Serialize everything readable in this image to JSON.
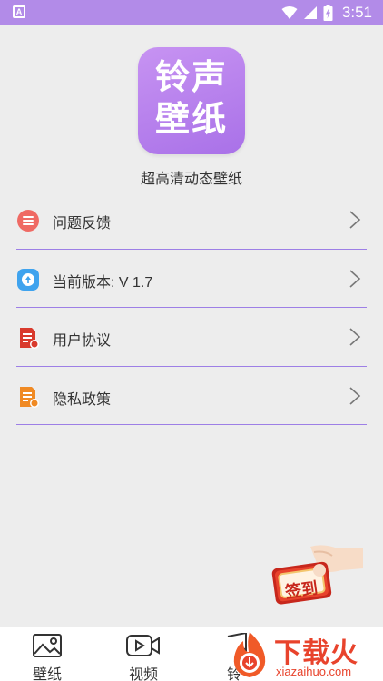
{
  "status_bar": {
    "time": "3:51",
    "app_indicator": "A",
    "icons": [
      "wifi-icon",
      "signal-icon",
      "battery-icon"
    ]
  },
  "app": {
    "logo_line1": "铃声",
    "logo_line2": "壁纸",
    "subtitle": "超高清动态壁纸"
  },
  "menu": {
    "items": [
      {
        "label": "问题反馈",
        "icon": "feedback-icon"
      },
      {
        "label": "当前版本:   V 1.7",
        "icon": "version-icon"
      },
      {
        "label": "用户协议",
        "icon": "agreement-icon"
      },
      {
        "label": "隐私政策",
        "icon": "privacy-icon"
      }
    ]
  },
  "checkin": {
    "label": "签到"
  },
  "tabs": [
    {
      "label": "壁纸",
      "icon": "image-icon"
    },
    {
      "label": "视频",
      "icon": "video-icon"
    },
    {
      "label": "铃",
      "icon": "ringtone-icon"
    }
  ],
  "watermark": {
    "text": "下载火",
    "url": "xiazaihuo.com"
  },
  "colors": {
    "accent": "#b28be8",
    "divider": "#9d7fe6",
    "watermark": "#e8432c"
  }
}
